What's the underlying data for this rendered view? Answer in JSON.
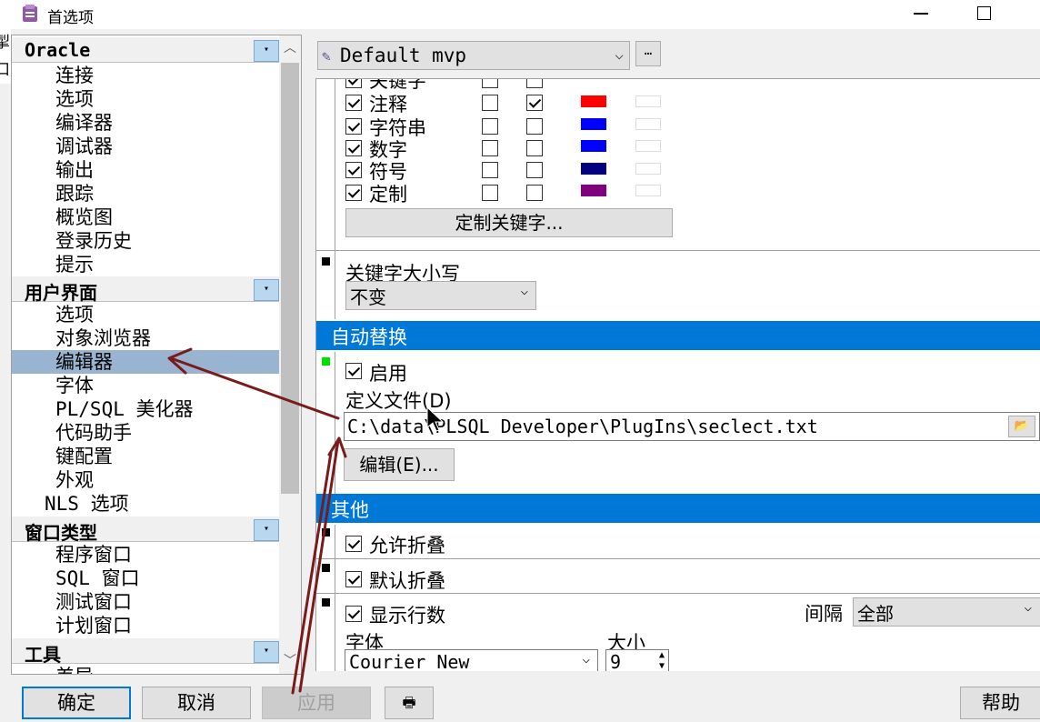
{
  "window": {
    "title": "首选项",
    "behind_text": [
      "掣",
      "口"
    ]
  },
  "tree": {
    "sections": [
      {
        "label": "Oracle",
        "items": [
          "连接",
          "选项",
          "编译器",
          "调试器",
          "输出",
          "跟踪",
          "概览图",
          "登录历史",
          "提示"
        ]
      },
      {
        "label": "用户界面",
        "items": [
          "选项",
          "对象浏览器",
          "编辑器",
          "字体",
          "PL/SQL 美化器",
          "代码助手",
          "键配置",
          "外观"
        ],
        "extra": "NLS 选项"
      },
      {
        "label": "窗口类型",
        "items": [
          "程序窗口",
          "SQL 窗口",
          "测试窗口",
          "计划窗口"
        ]
      },
      {
        "label": "工具",
        "items": [
          "差异"
        ]
      }
    ],
    "selected": "编辑器"
  },
  "profile": {
    "value": "Default mvp",
    "more_label": "…"
  },
  "syntax": {
    "partial_row": "关键字",
    "rows": [
      {
        "label": "注释",
        "enabled": true,
        "bold": false,
        "italic": true,
        "color": "#ff0000"
      },
      {
        "label": "字符串",
        "enabled": true,
        "bold": false,
        "italic": false,
        "color": "#0000ff"
      },
      {
        "label": "数字",
        "enabled": true,
        "bold": false,
        "italic": false,
        "color": "#0000ff"
      },
      {
        "label": "符号",
        "enabled": true,
        "bold": false,
        "italic": false,
        "color": "#000080"
      },
      {
        "label": "定制",
        "enabled": true,
        "bold": false,
        "italic": false,
        "color": "#800080"
      }
    ],
    "custom_keywords_button": "定制关键字..."
  },
  "keyword_case": {
    "label": "关键字大小写",
    "value": "不变"
  },
  "autoreplace": {
    "header": "自动替换",
    "enable_label": "启用",
    "enabled": true,
    "file_label": "定义文件(D)",
    "file_path": "C:\\data\\PLSQL Developer\\PlugIns\\seclect.txt",
    "edit_button": "编辑(E)..."
  },
  "other": {
    "header": "其他",
    "allow_fold": "允许折叠",
    "default_fold": "默认折叠",
    "show_line_numbers": "显示行数",
    "interval_label": "间隔",
    "interval_value": "全部",
    "font_label": "字体",
    "font_value": "Courier New",
    "size_label": "大小",
    "size_value": "9"
  },
  "buttons": {
    "ok": "确定",
    "cancel": "取消",
    "apply": "应用",
    "help": "帮助"
  },
  "colors": {
    "accent": "#0078d7",
    "selection": "#99b4d1",
    "arrow": "#7a1a1a"
  }
}
